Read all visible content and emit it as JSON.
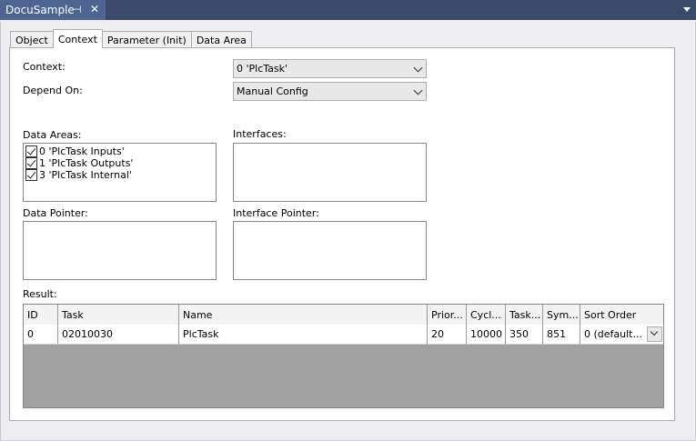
{
  "window": {
    "doc_tab_title": "DocuSample",
    "pin_glyph": "⊣",
    "close_glyph": "✕"
  },
  "tabs": [
    {
      "label": "Object"
    },
    {
      "label": "Context",
      "active": true
    },
    {
      "label": "Parameter (Init)"
    },
    {
      "label": "Data Area"
    }
  ],
  "form": {
    "context_label": "Context:",
    "context_value": "0 'PlcTask'",
    "depend_label": "Depend On:",
    "depend_value": "Manual Config",
    "data_areas_label": "Data Areas:",
    "data_areas": [
      {
        "label": "0 'PlcTask Inputs'",
        "checked": true
      },
      {
        "label": "1 'PlcTask Outputs'",
        "checked": true
      },
      {
        "label": "3 'PlcTask Internal'",
        "checked": true
      }
    ],
    "interfaces_label": "Interfaces:",
    "data_pointer_label": "Data Pointer:",
    "interface_pointer_label": "Interface Pointer:",
    "result_label": "Result:"
  },
  "result_table": {
    "columns": [
      "ID",
      "Task",
      "Name",
      "Prior...",
      "Cycl...",
      "Task...",
      "Sym...",
      "Sort Order"
    ],
    "rows": [
      [
        "0",
        "02010030",
        "PlcTask",
        "20",
        "10000",
        "350",
        "851",
        "0 (default..."
      ]
    ]
  },
  "colors": {
    "title_bar": "#3b4a6b",
    "active_doc_tab": "#4f6591",
    "grid_empty": "#a0a0a0"
  }
}
